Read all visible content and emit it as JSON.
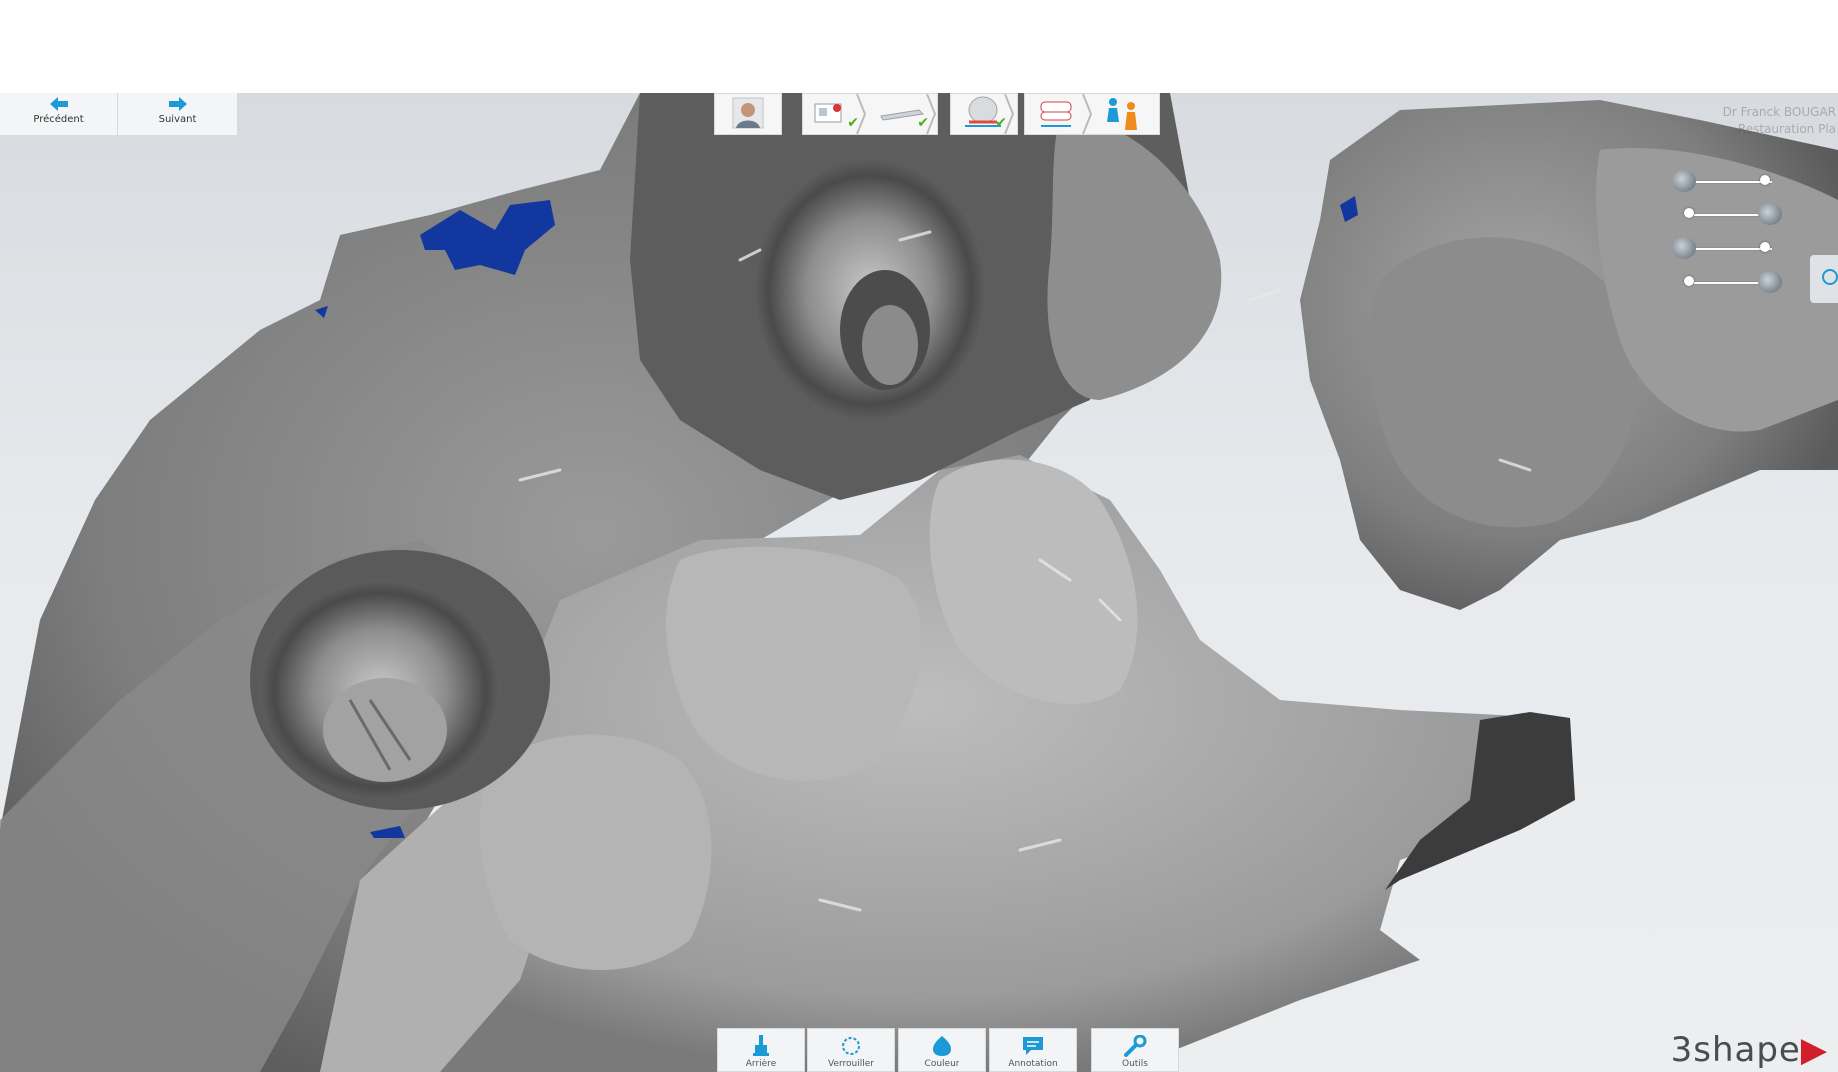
{
  "nav": {
    "previous_label": "Précédent",
    "next_label": "Suivant"
  },
  "workflow": {
    "steps": [
      {
        "name": "patient",
        "completed": false
      },
      {
        "name": "order-form",
        "completed": true
      },
      {
        "name": "scan",
        "completed": true
      },
      {
        "name": "3d-view",
        "completed": true
      },
      {
        "name": "bite",
        "completed": false
      },
      {
        "name": "send",
        "completed": false
      }
    ]
  },
  "toolbar": {
    "buttons": [
      {
        "label": "Arrière",
        "icon": "brush-icon"
      },
      {
        "label": "Verrouiller",
        "icon": "lasso-icon"
      },
      {
        "label": "Couleur",
        "icon": "drop-icon"
      },
      {
        "label": "Annotation",
        "icon": "comment-icon"
      },
      {
        "label": "Outils",
        "icon": "wrench-icon"
      }
    ]
  },
  "user": {
    "line1": "Dr Franck BOUGAR",
    "line2": "Restauration Pla"
  },
  "brand": {
    "name": "3shape",
    "accent": "▶"
  },
  "colors": {
    "accent": "#1b9ad6",
    "check": "#4ab018",
    "scan_blue": "#1238a0"
  }
}
